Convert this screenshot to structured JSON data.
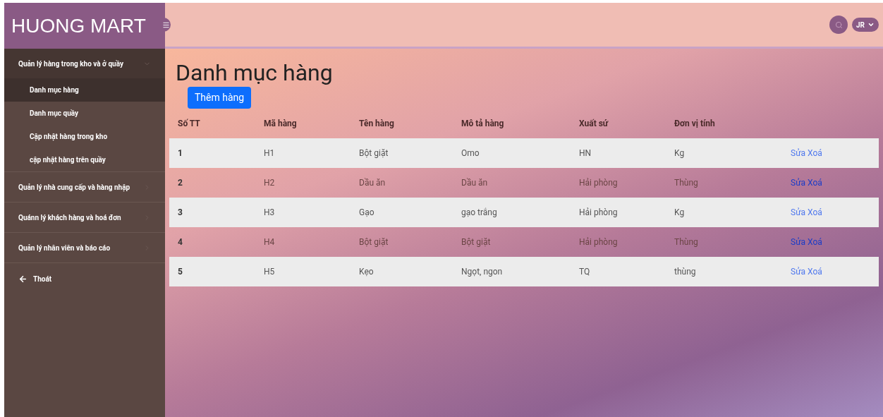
{
  "brand": "HUONG MART",
  "header": {
    "user": "JR"
  },
  "sidebar": {
    "groups": [
      {
        "label": "Quản lý hàng trong kho và ở quầy",
        "expanded": true,
        "children": [
          {
            "label": "Danh mục hàng",
            "selected": true
          },
          {
            "label": "Danh mục quầy",
            "selected": false
          },
          {
            "label": "Cập nhật hàng trong kho",
            "selected": false
          },
          {
            "label": "cập nhật hàng trên quầy",
            "selected": false
          }
        ]
      },
      {
        "label": "Quản lý nhà cung cấp và hàng nhập",
        "expanded": false
      },
      {
        "label": "Quánn lý khách hàng và hoá đơn",
        "expanded": false
      },
      {
        "label": "Quản lý nhân viên và báo cáo",
        "expanded": false
      }
    ],
    "logout": "Thoát"
  },
  "page": {
    "title": "Danh mục hàng",
    "add_button": "Thêm hàng"
  },
  "table": {
    "columns": [
      "Số TT",
      "Mã hàng",
      "Tên hàng",
      "Mô tả hàng",
      "Xuất sứ",
      "Đơn vị tính"
    ],
    "rows": [
      {
        "cells": [
          "1",
          "H1",
          "Bột giặt",
          "Omo",
          "HN",
          "Kg"
        ],
        "actions": [
          "Sửa",
          "Xoá"
        ]
      },
      {
        "cells": [
          "2",
          "H2",
          "Dầu ăn",
          "Dầu ăn",
          "Hải phòng",
          "Thùng"
        ],
        "actions": [
          "Sửa",
          "Xoá"
        ]
      },
      {
        "cells": [
          "3",
          "H3",
          "Gạo",
          "gạo trắng",
          "Hải phòng",
          "Kg"
        ],
        "actions": [
          "Sửa",
          "Xoá"
        ]
      },
      {
        "cells": [
          "4",
          "H4",
          "Bột giặt",
          "Bột giặt",
          "Hải phòng",
          "Thùng"
        ],
        "actions": [
          "Sửa",
          "Xoá"
        ]
      },
      {
        "cells": [
          "5",
          "H5",
          "Kẹo",
          "Ngọt, ngon",
          "TQ",
          "thùng"
        ],
        "actions": [
          "Sửa",
          "Xoá"
        ]
      }
    ]
  }
}
